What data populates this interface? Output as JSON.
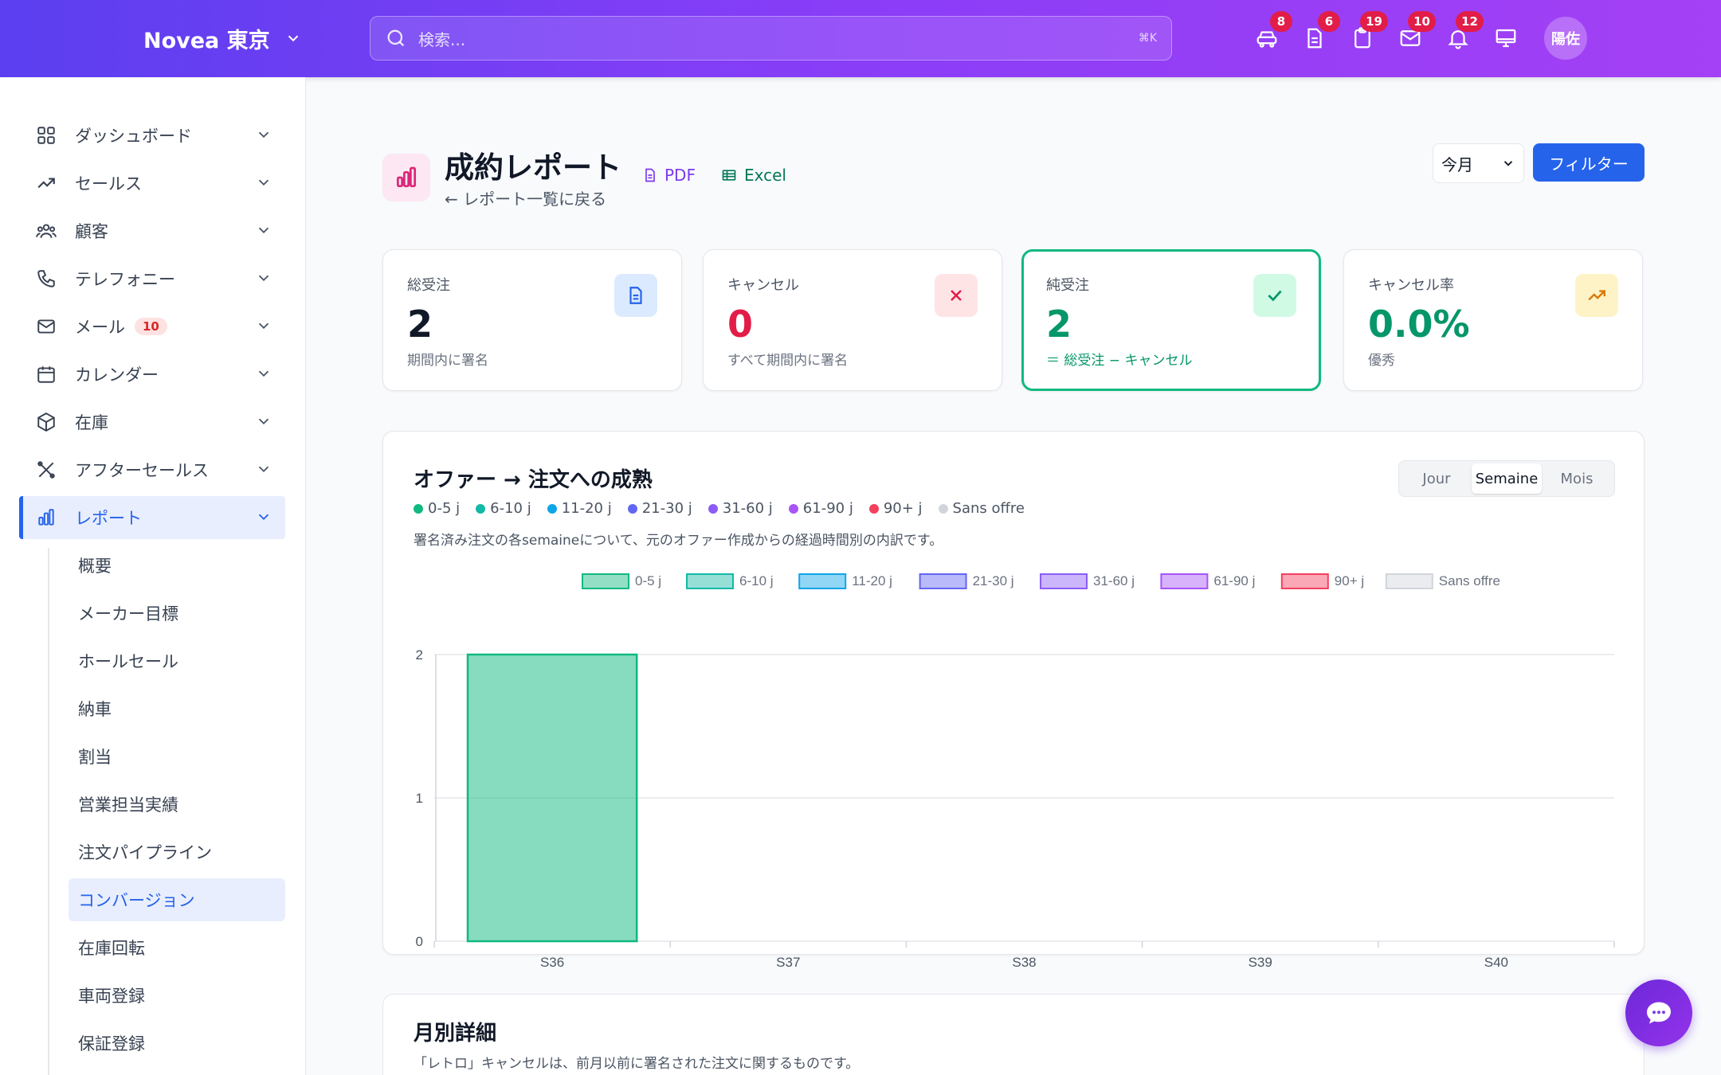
{
  "topbar": {
    "brand": "Novea 東京",
    "search_placeholder": "検索...",
    "search_shortcut": "⌘K",
    "icons": [
      {
        "name": "car-icon",
        "badge": "8"
      },
      {
        "name": "document-icon",
        "badge": "6"
      },
      {
        "name": "clipboard-icon",
        "badge": "19"
      },
      {
        "name": "mail-icon",
        "badge": "10"
      },
      {
        "name": "bell-icon",
        "badge": "12"
      },
      {
        "name": "monitor-icon",
        "badge": ""
      }
    ],
    "avatar": "陽佐"
  },
  "sidebar": {
    "items": [
      {
        "label": "ダッシュボード",
        "icon": "grid-icon"
      },
      {
        "label": "セールス",
        "icon": "trend-icon"
      },
      {
        "label": "顧客",
        "icon": "users-icon"
      },
      {
        "label": "テレフォニー",
        "icon": "phone-icon"
      },
      {
        "label": "メール",
        "icon": "mail-icon",
        "badge": "10"
      },
      {
        "label": "カレンダー",
        "icon": "calendar-icon"
      },
      {
        "label": "在庫",
        "icon": "box-icon"
      },
      {
        "label": "アフターセールス",
        "icon": "tools-icon"
      },
      {
        "label": "レポート",
        "icon": "chart-icon",
        "active": true
      }
    ],
    "subitems": [
      "概要",
      "メーカー目標",
      "ホールセール",
      "納車",
      "割当",
      "営業担当実績",
      "注文パイプライン",
      "コンバージョン",
      "在庫回転",
      "車両登録",
      "保証登録"
    ],
    "active_sub": "コンバージョン"
  },
  "page": {
    "title": "成約レポート",
    "back": "← レポート一覧に戻る",
    "pdf": "PDF",
    "excel": "Excel",
    "period": "今月",
    "filter": "フィルター"
  },
  "cards": [
    {
      "label": "総受注",
      "value": "2",
      "sub": "期間内に署名",
      "color": "#111827",
      "subcolor": "#6b7280"
    },
    {
      "label": "キャンセル",
      "value": "0",
      "sub": "すべて期間内に署名",
      "color": "#e11d48",
      "subcolor": "#6b7280"
    },
    {
      "label": "純受注",
      "value": "2",
      "sub": "＝ 総受注 − キャンセル",
      "color": "#059669",
      "subcolor": "#059669"
    },
    {
      "label": "キャンセル率",
      "value": "0.0%",
      "sub": "優秀",
      "color": "#059669",
      "subcolor": "#6b7280"
    }
  ],
  "chart_panel": {
    "title": "オファー → 注文への成熟",
    "description": "署名済み注文の各semaineについて、元のオファー作成からの経過時間別の内訳です。",
    "toggle": [
      "Jour",
      "Semaine",
      "Mois"
    ],
    "toggle_active": "Semaine"
  },
  "chart_data": {
    "type": "bar",
    "stacked": true,
    "categories": [
      "S36",
      "S37",
      "S38",
      "S39",
      "S40"
    ],
    "series": [
      {
        "name": "0-5 j",
        "values": [
          2,
          0,
          0,
          0,
          0
        ],
        "color": "#10b981"
      },
      {
        "name": "6-10 j",
        "values": [
          0,
          0,
          0,
          0,
          0
        ],
        "color": "#14b8a6"
      },
      {
        "name": "11-20 j",
        "values": [
          0,
          0,
          0,
          0,
          0
        ],
        "color": "#0ea5e9"
      },
      {
        "name": "21-30 j",
        "values": [
          0,
          0,
          0,
          0,
          0
        ],
        "color": "#6366f1"
      },
      {
        "name": "31-60 j",
        "values": [
          0,
          0,
          0,
          0,
          0
        ],
        "color": "#8b5cf6"
      },
      {
        "name": "61-90 j",
        "values": [
          0,
          0,
          0,
          0,
          0
        ],
        "color": "#a855f7"
      },
      {
        "name": "90+ j",
        "values": [
          0,
          0,
          0,
          0,
          0
        ],
        "color": "#f43f5e"
      },
      {
        "name": "Sans offre",
        "values": [
          0,
          0,
          0,
          0,
          0
        ],
        "color": "#d1d5db"
      }
    ],
    "ylim": [
      0,
      2
    ],
    "yticks": [
      "0",
      "1",
      "2"
    ],
    "legend": "top",
    "grid": true
  },
  "monthly": {
    "title": "月別詳細",
    "note": "「レトロ」キャンセルは、前月以前に署名された注文に関するものです。"
  }
}
